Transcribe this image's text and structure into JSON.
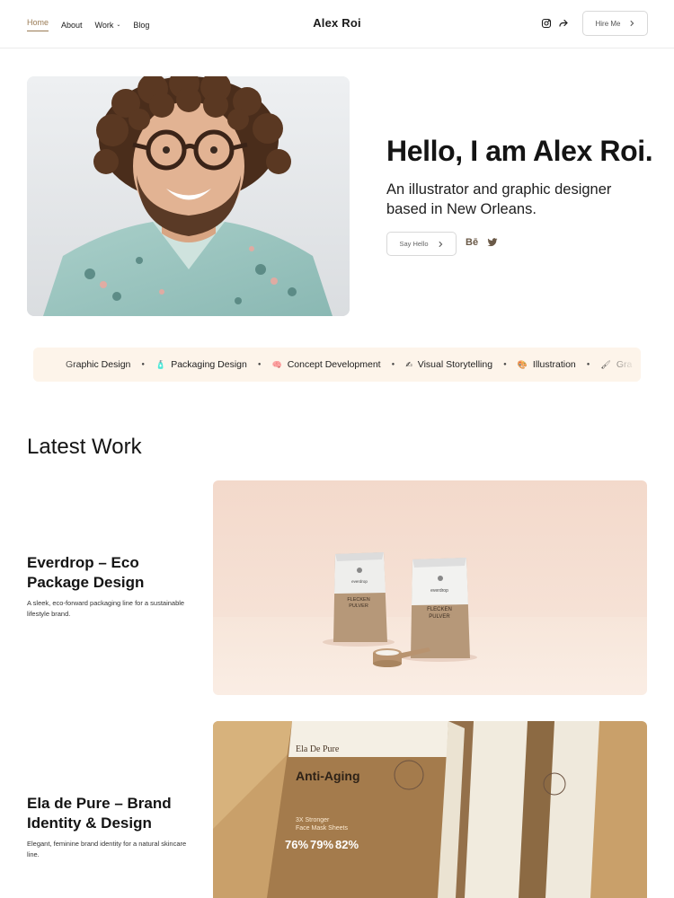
{
  "header": {
    "nav": [
      {
        "label": "Home",
        "active": true
      },
      {
        "label": "About"
      },
      {
        "label": "Work",
        "has_dropdown": true
      },
      {
        "label": "Blog"
      }
    ],
    "brand": "Alex Roi",
    "icons": [
      "instagram-icon",
      "share-icon"
    ],
    "hire_label": "Hire Me"
  },
  "hero": {
    "title": "Hello, I am Alex Roi.",
    "subtitle": "An illustrator and graphic designer based in New Orleans.",
    "cta_label": "Say Hello",
    "social": {
      "behance": "Bē"
    }
  },
  "marquee": {
    "items": [
      {
        "emoji": "",
        "label": "Graphic Design"
      },
      {
        "emoji": "🧴",
        "label": "Packaging Design"
      },
      {
        "emoji": "🧠",
        "label": "Concept Development"
      },
      {
        "emoji": "✍",
        "label": "Visual Storytelling"
      },
      {
        "emoji": "🎨",
        "label": "Illustration"
      },
      {
        "emoji": "🖌",
        "label": "Gra"
      }
    ]
  },
  "work": {
    "title": "Latest Work",
    "projects": [
      {
        "title": "Everdrop – Eco Package Design",
        "description": "A sleek, eco-forward packaging line for a sustainable lifestyle brand.",
        "image_text": {
          "brand": "everdrop",
          "line1": "FLECKEN",
          "line2": "PULVER"
        }
      },
      {
        "title": "Ela de Pure – Brand Identity & Design",
        "description": "Elegant, feminine brand identity for a natural skincare line.",
        "image_text": {
          "brand": "Ela De Pure",
          "product": "Anti-Aging",
          "tagline": "3X Stronger",
          "tagline2": "Face Mask Sheets",
          "stats": [
            "76%",
            "79%",
            "82%"
          ]
        }
      }
    ]
  },
  "colors": {
    "accent": "#9a7b55",
    "marquee_bg": "#fdf4ea"
  }
}
